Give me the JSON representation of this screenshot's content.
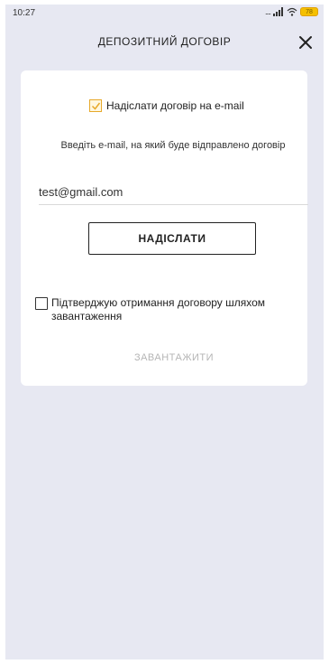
{
  "status_bar": {
    "time": "10:27",
    "signal": "....",
    "battery": "78"
  },
  "header": {
    "title": "ДЕПОЗИТНИЙ ДОГОВІР"
  },
  "email_option": {
    "checked": true,
    "label": "Надіслати договір на e-mail",
    "instruction": "Введіть e-mail, на який буде відправлено договір",
    "email_value": "test@gmail.com",
    "send_label": "НАДІСЛАТИ"
  },
  "download_option": {
    "checked": false,
    "label": "Підтверджую отримання договору шляхом завантаження",
    "download_label": "ЗАВАНТАЖИТИ"
  },
  "colors": {
    "background": "#e7e8f2",
    "checkbox_checked": "#e7a92a",
    "disabled_text": "#b5b5b5"
  }
}
